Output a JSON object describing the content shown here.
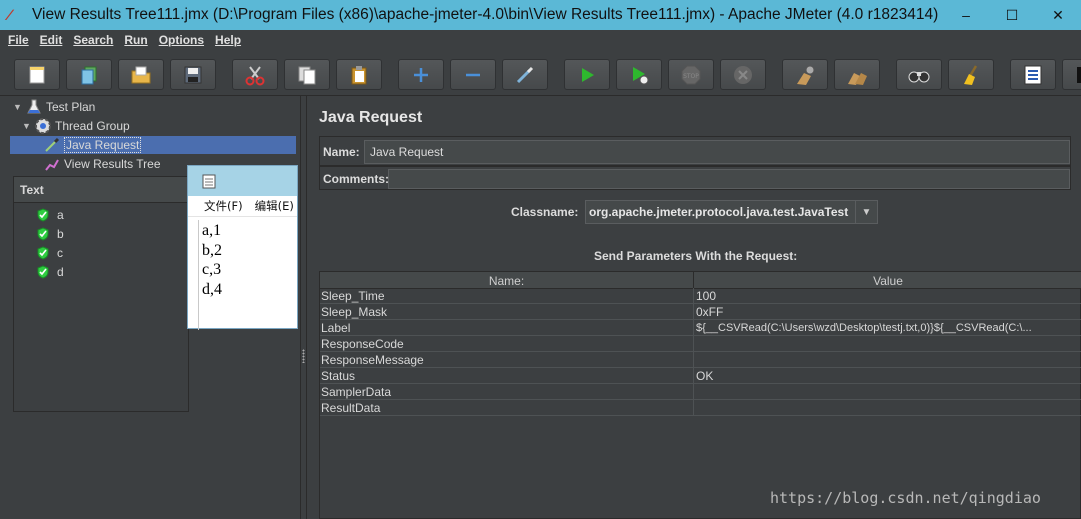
{
  "window": {
    "title": "View Results Tree111.jmx (D:\\Program Files (x86)\\apache-jmeter-4.0\\bin\\View Results Tree111.jmx) - Apache JMeter (4.0 r1823414)",
    "controls": [
      "–",
      "☐",
      "✕"
    ]
  },
  "menu": [
    "File",
    "Edit",
    "Search",
    "Run",
    "Options",
    "Help"
  ],
  "toolbar": {
    "buttons": [
      "new-icon",
      "templates-icon",
      "open-icon",
      "save-icon",
      "cut-icon",
      "copy-icon",
      "paste-icon",
      "expand-icon",
      "collapse-icon",
      "toggle-icon",
      "start-icon",
      "start-no-pause-icon",
      "stop-icon",
      "shutdown-icon",
      "clear-icon",
      "clear-all-icon",
      "search-icon",
      "reset-search-icon",
      "function-helper-icon"
    ]
  },
  "tree": {
    "items": [
      {
        "label": "Test Plan"
      },
      {
        "label": "Thread Group"
      },
      {
        "label": "Java Request"
      },
      {
        "label": "View Results Tree"
      }
    ]
  },
  "results": {
    "header": "Text",
    "items": [
      "a",
      "b",
      "c",
      "d"
    ]
  },
  "notepad": {
    "menu": [
      "文件(F)",
      "编辑(E)"
    ],
    "lines": [
      "a,1",
      "b,2",
      "c,3",
      "d,4"
    ]
  },
  "panel": {
    "title": "Java Request",
    "name_label": "Name:",
    "name_value": "Java Request",
    "comments_label": "Comments:",
    "classname_label": "Classname:",
    "classname_value": "org.apache.jmeter.protocol.java.test.JavaTest",
    "params_title": "Send Parameters With the Request:",
    "table": {
      "headers": [
        "Name:",
        "Value"
      ],
      "rows": [
        {
          "name": "Sleep_Time",
          "value": "100"
        },
        {
          "name": "Sleep_Mask",
          "value": "0xFF"
        },
        {
          "name": "Label",
          "value": "${__CSVRead(C:\\Users\\wzd\\Desktop\\testj.txt,0)}${__CSVRead(C:\\..."
        },
        {
          "name": "ResponseCode",
          "value": ""
        },
        {
          "name": "ResponseMessage",
          "value": ""
        },
        {
          "name": "Status",
          "value": "OK"
        },
        {
          "name": "SamplerData",
          "value": ""
        },
        {
          "name": "ResultData",
          "value": ""
        }
      ]
    }
  },
  "watermark": "https://blog.csdn.net/qingdiao",
  "colors": {
    "background": "#3c3f41",
    "titlebar": "#5bb8d6",
    "selection": "#4b6eaf",
    "success_green": "#2ecc40"
  }
}
